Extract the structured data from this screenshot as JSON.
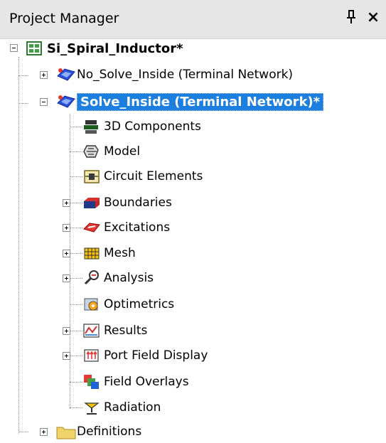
{
  "panel": {
    "title": "Project Manager",
    "pin_glyph": "\u0001",
    "close_glyph": "×"
  },
  "tree": {
    "root": {
      "label": "Si_Spiral_Inductor*",
      "icon": "project-icon",
      "expanded": true
    },
    "designs": [
      {
        "label": "No_Solve_Inside (Terminal Network)",
        "icon": "hfss-design-icon",
        "expanded": false,
        "selected": false
      },
      {
        "label": "Solve_Inside (Terminal Network)*",
        "icon": "hfss-design-icon",
        "expanded": true,
        "selected": true
      }
    ],
    "children": [
      {
        "label": "3D Components",
        "icon": "3d-components-icon",
        "expandable": false
      },
      {
        "label": "Model",
        "icon": "model-icon",
        "expandable": false
      },
      {
        "label": "Circuit Elements",
        "icon": "circuit-elements-icon",
        "expandable": false
      },
      {
        "label": "Boundaries",
        "icon": "boundaries-icon",
        "expandable": true
      },
      {
        "label": "Excitations",
        "icon": "excitations-icon",
        "expandable": true
      },
      {
        "label": "Mesh",
        "icon": "mesh-icon",
        "expandable": true
      },
      {
        "label": "Analysis",
        "icon": "analysis-icon",
        "expandable": true
      },
      {
        "label": "Optimetrics",
        "icon": "optimetrics-icon",
        "expandable": false
      },
      {
        "label": "Results",
        "icon": "results-icon",
        "expandable": true
      },
      {
        "label": "Port Field Display",
        "icon": "port-field-display-icon",
        "expandable": true
      },
      {
        "label": "Field Overlays",
        "icon": "field-overlays-icon",
        "expandable": false
      },
      {
        "label": "Radiation",
        "icon": "radiation-icon",
        "expandable": false
      }
    ],
    "definitions": {
      "label": "Definitions",
      "icon": "folder-icon",
      "expanded": false
    }
  }
}
